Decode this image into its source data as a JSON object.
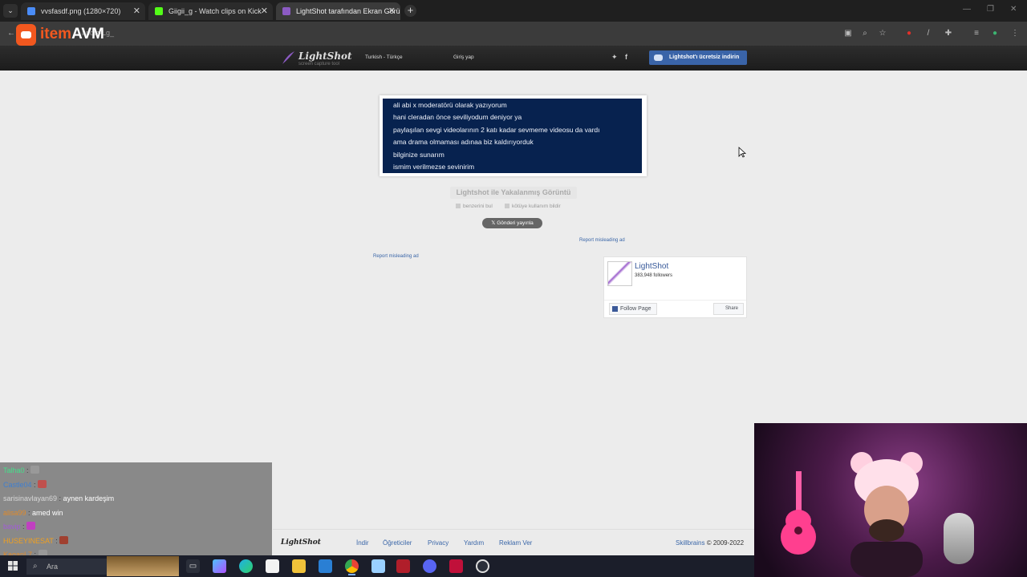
{
  "browser": {
    "tabs": [
      {
        "title": "vvsfasdf.png (1280×720)",
        "active": false,
        "favicon_color": "#4a8cf7"
      },
      {
        "title": "Giigii_g - Watch clips on Kick",
        "active": false,
        "favicon_color": "#53fc18"
      },
      {
        "title": "LightShot tarafından Ekran Görü",
        "active": true,
        "favicon_color": "#8c5bc4"
      }
    ],
    "url": "apqtz-Lg_"
  },
  "overlay_logo": {
    "part1": "item",
    "part2": "AVM"
  },
  "header": {
    "logo_name": "LightShot",
    "logo_tagline": "screen capture tool",
    "language": "Turkish - Türkçe",
    "login": "Giriş yap",
    "download_button": "Lightshot'ı ücretsiz indirin"
  },
  "screenshot": {
    "lines": [
      "ali abi x moderatörü olarak yazıyorum",
      "hani cleradan önce seviliyodum deniyor ya",
      "paylaşılan sevgi videolarının 2 katı kadar sevmeme videosu da vardı",
      "ama drama olmaması adınaa biz kaldırıyorduk",
      "bilginize sunarım",
      "ismim verilmezse sevinirim"
    ],
    "background_color": "#07224f"
  },
  "caption": "Lightshot ile Yakalanmış Görüntü",
  "actions": {
    "find_similar": "benzerini bul",
    "report_abuse": "kötüye kullanım bildir"
  },
  "tweet_button": "Gönderi yayınla",
  "ads": {
    "report_right": "Report misleading ad",
    "report_left": "Report misleading ad"
  },
  "facebook": {
    "page_name": "LightShot",
    "followers": "383,948 followers",
    "follow_button": "Follow Page",
    "share_button": "Share"
  },
  "footer": {
    "logo": "LightShot",
    "links": [
      "İndir",
      "Öğreticiler",
      "Privacy",
      "Yardım",
      "Reklam Ver"
    ],
    "company": "Skillbrains",
    "copyright": "© 2009-2022"
  },
  "chat": {
    "messages": [
      {
        "user": "Talha0",
        "color": "#44e08a",
        "text": ""
      },
      {
        "user": "Castle04",
        "color": "#3f7fd0",
        "text": ""
      },
      {
        "user": "sarisinavlayan69",
        "color": "#d8d8d8",
        "text": "aynen kardeşim"
      },
      {
        "user": "alisa99",
        "color": "#e08a2a",
        "text": "amed win"
      },
      {
        "user": "bavip",
        "color": "#a25bd8",
        "text": ""
      },
      {
        "user": "HUSEYINESAT",
        "color": "#f0a020",
        "text": ""
      },
      {
        "user": "KaganL7",
        "color": "#e08a2a",
        "text": ""
      }
    ]
  },
  "taskbar": {
    "search_placeholder": "Ara"
  }
}
